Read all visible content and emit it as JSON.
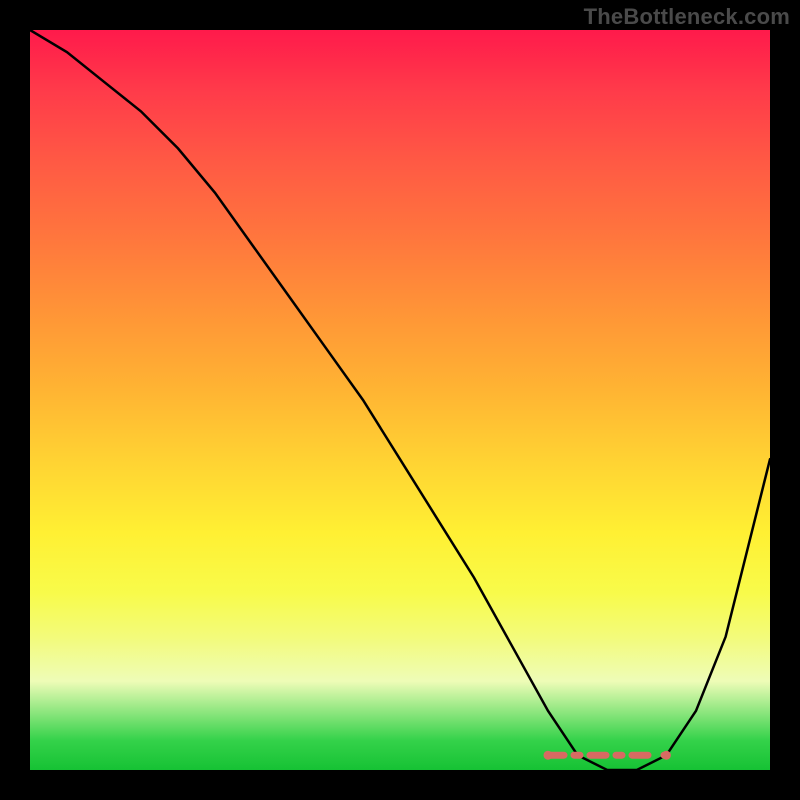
{
  "watermark": "TheBottleneck.com",
  "colors": {
    "background": "#000000",
    "gradient_top": "#ff1a4b",
    "gradient_mid": "#ffd233",
    "gradient_bottom": "#16c234",
    "curve": "#000000",
    "marker": "#d86a62",
    "watermark_text": "#4a4a4a"
  },
  "chart_data": {
    "type": "line",
    "title": "",
    "xlabel": "",
    "ylabel": "",
    "xlim": [
      0,
      100
    ],
    "ylim": [
      0,
      100
    ],
    "grid": false,
    "legend": false,
    "series": [
      {
        "name": "bottleneck-curve",
        "x": [
          0,
          5,
          10,
          15,
          20,
          25,
          30,
          35,
          40,
          45,
          50,
          55,
          60,
          65,
          70,
          74,
          78,
          82,
          86,
          90,
          94,
          100
        ],
        "values": [
          100,
          97,
          93,
          89,
          84,
          78,
          71,
          64,
          57,
          50,
          42,
          34,
          26,
          17,
          8,
          2,
          0,
          0,
          2,
          8,
          18,
          42
        ]
      }
    ],
    "annotations": [
      {
        "type": "dashed-segment",
        "description": "optimal zone marker near minimum",
        "color": "#d86a62",
        "x": [
          70,
          86
        ],
        "y": [
          2,
          2
        ]
      }
    ]
  }
}
